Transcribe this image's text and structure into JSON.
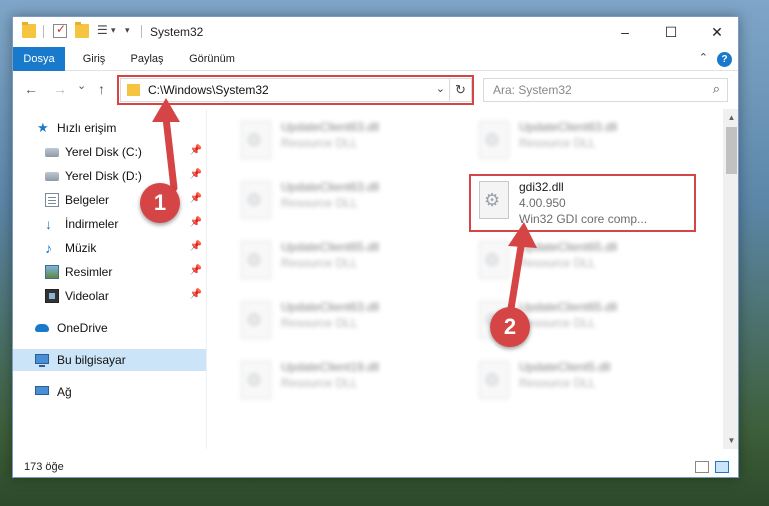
{
  "window": {
    "title": "System32",
    "minimize_label": "–",
    "maximize_label": "☐",
    "close_label": "✕"
  },
  "ribbon": {
    "tabs": [
      {
        "label": "Dosya",
        "active": true
      },
      {
        "label": "Giriş",
        "active": false
      },
      {
        "label": "Paylaş",
        "active": false
      },
      {
        "label": "Görünüm",
        "active": false
      }
    ],
    "help_label": "?",
    "collapse_label": "⌃"
  },
  "nav": {
    "back_label": "←",
    "forward_label": "→",
    "recent_label": "⌄",
    "up_label": "↑",
    "address": "C:\\Windows\\System32",
    "address_dropdown": "⌄",
    "refresh_label": "↻",
    "search_placeholder": "Ara: System32",
    "search_icon": "⌕"
  },
  "sidebar": {
    "quick_access": {
      "label": "Hızlı erişim",
      "icon": "star-icon"
    },
    "items": [
      {
        "label": "Yerel Disk (C:)",
        "icon": "drive-icon",
        "pinned": true
      },
      {
        "label": "Yerel Disk (D:)",
        "icon": "drive-icon",
        "pinned": true
      },
      {
        "label": "Belgeler",
        "icon": "documents-icon",
        "pinned": true
      },
      {
        "label": "İndirmeler",
        "icon": "download-icon",
        "pinned": true
      },
      {
        "label": "Müzik",
        "icon": "music-icon",
        "pinned": true
      },
      {
        "label": "Resimler",
        "icon": "pictures-icon",
        "pinned": true
      },
      {
        "label": "Videolar",
        "icon": "videos-icon",
        "pinned": true
      }
    ],
    "onedrive": {
      "label": "OneDrive",
      "icon": "cloud-icon"
    },
    "this_pc": {
      "label": "Bu bilgisayar",
      "icon": "computer-icon",
      "selected": true
    },
    "network": {
      "label": "Ağ",
      "icon": "network-icon"
    },
    "pin_glyph": "📌"
  },
  "files": {
    "left_column": [
      {
        "name": "UpdateClient63.dll",
        "desc": "Resource DLL"
      },
      {
        "name": "UpdateClient63.dll",
        "desc": "Resource DLL"
      },
      {
        "name": "UpdateClient65.dll",
        "desc": "Resource DLL"
      },
      {
        "name": "UpdateClient63.dll",
        "desc": "Resource DLL"
      },
      {
        "name": "UpdateClient19.dll",
        "desc": "Resource DLL"
      }
    ],
    "right_column": [
      {
        "name": "UpdateClient63.dll",
        "desc": "Resource DLL"
      },
      {
        "name": "UpdateClient65.dll",
        "desc": "Resource DLL"
      },
      {
        "name": "UpdateClient65.dll",
        "desc": "Resource DLL"
      },
      {
        "name": "UpdateClient5.dll",
        "desc": "Resource DLL"
      }
    ],
    "highlighted": {
      "name": "gdi32.dll",
      "version": "4.00.950",
      "desc": "Win32 GDI core comp..."
    }
  },
  "status": {
    "count": "173 öğe"
  },
  "annotations": {
    "step1": "1",
    "step2": "2",
    "color": "#d64545"
  },
  "scrollbar": {
    "up_label": "▲",
    "down_label": "▼"
  }
}
